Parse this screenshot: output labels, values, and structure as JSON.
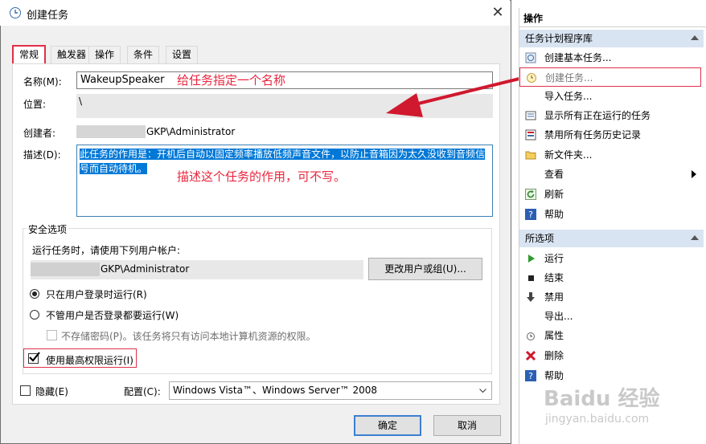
{
  "dialog": {
    "title": "创建任务",
    "close_glyph": "✕",
    "tabs": [
      "常规",
      "触发器",
      "操作",
      "条件",
      "设置"
    ],
    "name_label": "名称(M):",
    "name_value": "WakeupSpeaker",
    "name_annotation": "给任务指定一个名称",
    "location_label": "位置:",
    "location_value": "\\",
    "author_label": "创建者:",
    "author_value": "GKP\\Administrator",
    "desc_label": "描述(D):",
    "desc_value": "此任务的作用是：开机后自动以固定频率播放低频声音文件，以防止音箱因为太久没收到音频信号而自动待机。",
    "desc_annotation": "描述这个任务的作用，可不写。",
    "security": {
      "title": "安全选项",
      "run_as_prompt": "运行任务时，请使用下列用户帐户:",
      "account_value": "GKP\\Administrator",
      "change_button": "更改用户或组(U)...",
      "radio_logged_on": "只在用户登录时运行(R)",
      "radio_any": "不管用户是否登录都要运行(W)",
      "no_store_password": "不存储密码(P)。该任务将只有访问本地计算机资源的权限。",
      "highest_privileges": "使用最高权限运行(I)"
    },
    "hidden_label": "隐藏(E)",
    "config_label": "配置(C):",
    "config_value": "Windows Vista™、Windows Server™ 2008",
    "ok_button": "确定",
    "cancel_button": "取消"
  },
  "actions_pane": {
    "header": "操作",
    "library_section": "任务计划程序库",
    "library_items": [
      {
        "label": "创建基本任务...",
        "icon": "wizard-icon"
      },
      {
        "label": "创建任务...",
        "icon": "task-icon"
      },
      {
        "label": "导入任务...",
        "icon": "import-icon"
      },
      {
        "label": "显示所有正在运行的任务",
        "icon": "running-tasks-icon"
      },
      {
        "label": "禁用所有任务历史记录",
        "icon": "history-icon"
      },
      {
        "label": "新文件夹...",
        "icon": "folder-icon"
      },
      {
        "label": "查看",
        "icon": "view-icon"
      },
      {
        "label": "刷新",
        "icon": "refresh-icon"
      },
      {
        "label": "帮助",
        "icon": "help-icon"
      }
    ],
    "selected_section": "所选项",
    "selected_items": [
      {
        "label": "运行",
        "icon": "run-icon"
      },
      {
        "label": "结束",
        "icon": "stop-icon"
      },
      {
        "label": "禁用",
        "icon": "disable-icon"
      },
      {
        "label": "导出...",
        "icon": "export-icon"
      },
      {
        "label": "属性",
        "icon": "properties-icon"
      },
      {
        "label": "删除",
        "icon": "delete-icon"
      },
      {
        "label": "帮助",
        "icon": "help-icon"
      }
    ]
  },
  "watermark": {
    "text_main": "Baidu 经验",
    "text_url": "jingyan.baidu.com"
  },
  "colors": {
    "annotation": "#e8263e",
    "selection": "#0078d7",
    "section_bg": "#d9e4f2"
  }
}
